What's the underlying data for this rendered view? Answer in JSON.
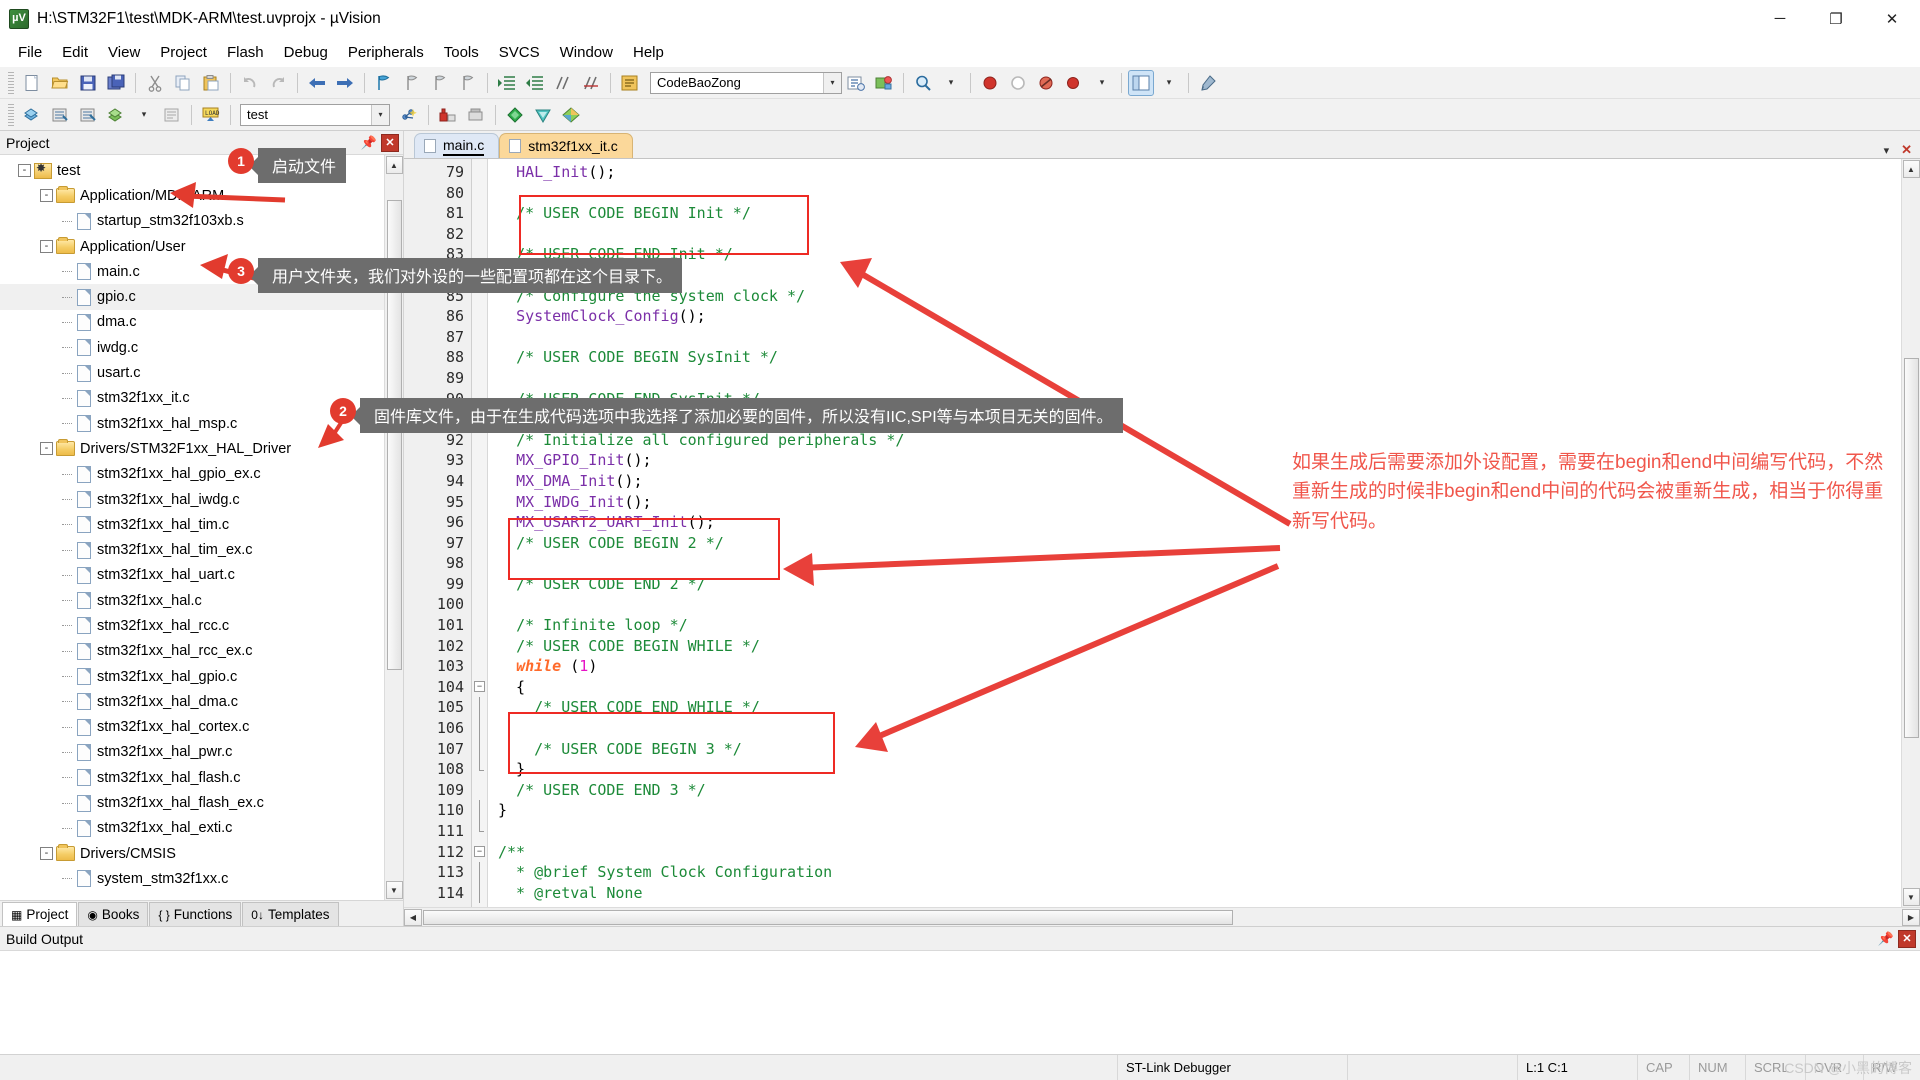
{
  "window": {
    "title": "H:\\STM32F1\\test\\MDK-ARM\\test.uvprojx - µVision",
    "app_icon": "uvision-icon",
    "minimize": "─",
    "maximize": "❐",
    "close": "✕"
  },
  "menubar": {
    "items": [
      "File",
      "Edit",
      "View",
      "Project",
      "Flash",
      "Debug",
      "Peripherals",
      "Tools",
      "SVCS",
      "Window",
      "Help"
    ]
  },
  "toolbar": {
    "target_combo": "CodeBaoZong",
    "project_combo": "test",
    "dropdown_arrow": "▾"
  },
  "project_panel": {
    "caption": "Project",
    "pin": "⚓",
    "close": "✕",
    "tree": [
      {
        "depth": 0,
        "label": "test",
        "icon": "project-icon",
        "twist": "-",
        "selected": false
      },
      {
        "depth": 1,
        "label": "Application/MDK-ARM",
        "icon": "folder-icon",
        "twist": "-",
        "selected": false
      },
      {
        "depth": 2,
        "label": "startup_stm32f103xb.s",
        "icon": "file-icon",
        "twist": "",
        "selected": false
      },
      {
        "depth": 1,
        "label": "Application/User",
        "icon": "folder-icon",
        "twist": "-",
        "selected": false
      },
      {
        "depth": 2,
        "label": "main.c",
        "icon": "file-icon",
        "twist": "",
        "selected": false
      },
      {
        "depth": 2,
        "label": "gpio.c",
        "icon": "file-icon",
        "twist": "",
        "selected": true
      },
      {
        "depth": 2,
        "label": "dma.c",
        "icon": "file-icon",
        "twist": "",
        "selected": false
      },
      {
        "depth": 2,
        "label": "iwdg.c",
        "icon": "file-icon",
        "twist": "",
        "selected": false
      },
      {
        "depth": 2,
        "label": "usart.c",
        "icon": "file-icon",
        "twist": "",
        "selected": false
      },
      {
        "depth": 2,
        "label": "stm32f1xx_it.c",
        "icon": "file-icon",
        "twist": "",
        "selected": false
      },
      {
        "depth": 2,
        "label": "stm32f1xx_hal_msp.c",
        "icon": "file-icon",
        "twist": "",
        "selected": false
      },
      {
        "depth": 1,
        "label": "Drivers/STM32F1xx_HAL_Driver",
        "icon": "folder-icon",
        "twist": "-",
        "selected": false
      },
      {
        "depth": 2,
        "label": "stm32f1xx_hal_gpio_ex.c",
        "icon": "file-icon",
        "twist": "",
        "selected": false
      },
      {
        "depth": 2,
        "label": "stm32f1xx_hal_iwdg.c",
        "icon": "file-icon",
        "twist": "",
        "selected": false
      },
      {
        "depth": 2,
        "label": "stm32f1xx_hal_tim.c",
        "icon": "file-icon",
        "twist": "",
        "selected": false
      },
      {
        "depth": 2,
        "label": "stm32f1xx_hal_tim_ex.c",
        "icon": "file-icon",
        "twist": "",
        "selected": false
      },
      {
        "depth": 2,
        "label": "stm32f1xx_hal_uart.c",
        "icon": "file-icon",
        "twist": "",
        "selected": false
      },
      {
        "depth": 2,
        "label": "stm32f1xx_hal.c",
        "icon": "file-icon",
        "twist": "",
        "selected": false
      },
      {
        "depth": 2,
        "label": "stm32f1xx_hal_rcc.c",
        "icon": "file-icon",
        "twist": "",
        "selected": false
      },
      {
        "depth": 2,
        "label": "stm32f1xx_hal_rcc_ex.c",
        "icon": "file-icon",
        "twist": "",
        "selected": false
      },
      {
        "depth": 2,
        "label": "stm32f1xx_hal_gpio.c",
        "icon": "file-icon",
        "twist": "",
        "selected": false
      },
      {
        "depth": 2,
        "label": "stm32f1xx_hal_dma.c",
        "icon": "file-icon",
        "twist": "",
        "selected": false
      },
      {
        "depth": 2,
        "label": "stm32f1xx_hal_cortex.c",
        "icon": "file-icon",
        "twist": "",
        "selected": false
      },
      {
        "depth": 2,
        "label": "stm32f1xx_hal_pwr.c",
        "icon": "file-icon",
        "twist": "",
        "selected": false
      },
      {
        "depth": 2,
        "label": "stm32f1xx_hal_flash.c",
        "icon": "file-icon",
        "twist": "",
        "selected": false
      },
      {
        "depth": 2,
        "label": "stm32f1xx_hal_flash_ex.c",
        "icon": "file-icon",
        "twist": "",
        "selected": false
      },
      {
        "depth": 2,
        "label": "stm32f1xx_hal_exti.c",
        "icon": "file-icon",
        "twist": "",
        "selected": false
      },
      {
        "depth": 1,
        "label": "Drivers/CMSIS",
        "icon": "folder-icon",
        "twist": "-",
        "selected": false
      },
      {
        "depth": 2,
        "label": "system_stm32f1xx.c",
        "icon": "file-icon",
        "twist": "",
        "selected": false
      }
    ],
    "bottom_tabs": [
      {
        "label": "Project",
        "glyph": "▦",
        "active": true
      },
      {
        "label": "Books",
        "glyph": "◉",
        "active": false
      },
      {
        "label": "Functions",
        "glyph": "{ }",
        "active": false
      },
      {
        "label": "Templates",
        "glyph": "0↓",
        "active": false
      }
    ]
  },
  "editor": {
    "tabs": [
      {
        "label": "main.c",
        "active": true
      },
      {
        "label": "stm32f1xx_it.c",
        "active": false
      }
    ],
    "tab_controls": {
      "dropdown": "▾",
      "close": "✕"
    },
    "first_line_number": 79,
    "lines": [
      {
        "n": 79,
        "fold": "",
        "segs": [
          {
            "t": "  ",
            "c": "pl"
          },
          {
            "t": "HAL_Init",
            "c": "fn"
          },
          {
            "t": "();",
            "c": "pl"
          }
        ]
      },
      {
        "n": 80,
        "fold": "",
        "segs": []
      },
      {
        "n": 81,
        "fold": "",
        "segs": [
          {
            "t": "  ",
            "c": "pl"
          },
          {
            "t": "/* USER CODE BEGIN Init */",
            "c": "cmt"
          }
        ]
      },
      {
        "n": 82,
        "fold": "",
        "segs": []
      },
      {
        "n": 83,
        "fold": "",
        "segs": [
          {
            "t": "  ",
            "c": "pl"
          },
          {
            "t": "/* USER CODE END Init */",
            "c": "cmt"
          }
        ]
      },
      {
        "n": 84,
        "fold": "",
        "segs": []
      },
      {
        "n": 85,
        "fold": "",
        "segs": [
          {
            "t": "  ",
            "c": "pl"
          },
          {
            "t": "/* Configure the system clock */",
            "c": "cmt"
          }
        ]
      },
      {
        "n": 86,
        "fold": "",
        "segs": [
          {
            "t": "  ",
            "c": "pl"
          },
          {
            "t": "SystemClock_Config",
            "c": "fn"
          },
          {
            "t": "();",
            "c": "pl"
          }
        ]
      },
      {
        "n": 87,
        "fold": "",
        "segs": []
      },
      {
        "n": 88,
        "fold": "",
        "segs": [
          {
            "t": "  ",
            "c": "pl"
          },
          {
            "t": "/* USER CODE BEGIN SysInit */",
            "c": "cmt"
          }
        ]
      },
      {
        "n": 89,
        "fold": "",
        "segs": []
      },
      {
        "n": 90,
        "fold": "",
        "segs": [
          {
            "t": "  ",
            "c": "pl"
          },
          {
            "t": "/* USER CODE END SysInit */",
            "c": "cmt"
          }
        ]
      },
      {
        "n": 91,
        "fold": "",
        "segs": []
      },
      {
        "n": 92,
        "fold": "",
        "segs": [
          {
            "t": "  ",
            "c": "pl"
          },
          {
            "t": "/* Initialize all configured peripherals */",
            "c": "cmt"
          }
        ]
      },
      {
        "n": 93,
        "fold": "",
        "segs": [
          {
            "t": "  ",
            "c": "pl"
          },
          {
            "t": "MX_GPIO_Init",
            "c": "fn"
          },
          {
            "t": "();",
            "c": "pl"
          }
        ]
      },
      {
        "n": 94,
        "fold": "",
        "segs": [
          {
            "t": "  ",
            "c": "pl"
          },
          {
            "t": "MX_DMA_Init",
            "c": "fn"
          },
          {
            "t": "();",
            "c": "pl"
          }
        ]
      },
      {
        "n": 95,
        "fold": "",
        "segs": [
          {
            "t": "  ",
            "c": "pl"
          },
          {
            "t": "MX_IWDG_Init",
            "c": "fn"
          },
          {
            "t": "();",
            "c": "pl"
          }
        ]
      },
      {
        "n": 96,
        "fold": "",
        "segs": [
          {
            "t": "  ",
            "c": "pl"
          },
          {
            "t": "MX_USART2_UART_Init",
            "c": "fn"
          },
          {
            "t": "();",
            "c": "pl"
          }
        ]
      },
      {
        "n": 97,
        "fold": "",
        "segs": [
          {
            "t": "  ",
            "c": "pl"
          },
          {
            "t": "/* USER CODE BEGIN 2 */",
            "c": "cmt"
          }
        ]
      },
      {
        "n": 98,
        "fold": "",
        "segs": []
      },
      {
        "n": 99,
        "fold": "",
        "segs": [
          {
            "t": "  ",
            "c": "pl"
          },
          {
            "t": "/* USER CODE END 2 */",
            "c": "cmt"
          }
        ]
      },
      {
        "n": 100,
        "fold": "",
        "segs": []
      },
      {
        "n": 101,
        "fold": "",
        "segs": [
          {
            "t": "  ",
            "c": "pl"
          },
          {
            "t": "/* Infinite loop */",
            "c": "cmt"
          }
        ]
      },
      {
        "n": 102,
        "fold": "",
        "segs": [
          {
            "t": "  ",
            "c": "pl"
          },
          {
            "t": "/* USER CODE BEGIN WHILE */",
            "c": "cmt"
          }
        ]
      },
      {
        "n": 103,
        "fold": "",
        "segs": [
          {
            "t": "  ",
            "c": "pl"
          },
          {
            "t": "while",
            "c": "kw"
          },
          {
            "t": " (",
            "c": "pl"
          },
          {
            "t": "1",
            "c": "num"
          },
          {
            "t": ")",
            "c": "pl"
          }
        ]
      },
      {
        "n": 104,
        "fold": "-",
        "segs": [
          {
            "t": "  {",
            "c": "pl"
          }
        ]
      },
      {
        "n": 105,
        "fold": "|",
        "segs": [
          {
            "t": "    ",
            "c": "pl"
          },
          {
            "t": "/* USER CODE END WHILE */",
            "c": "cmt"
          }
        ]
      },
      {
        "n": 106,
        "fold": "|",
        "segs": []
      },
      {
        "n": 107,
        "fold": "|",
        "segs": [
          {
            "t": "    ",
            "c": "pl"
          },
          {
            "t": "/* USER CODE BEGIN 3 */",
            "c": "cmt"
          }
        ]
      },
      {
        "n": 108,
        "fold": "e",
        "segs": [
          {
            "t": "  }",
            "c": "pl"
          }
        ]
      },
      {
        "n": 109,
        "fold": "",
        "segs": [
          {
            "t": "  ",
            "c": "pl"
          },
          {
            "t": "/* USER CODE END 3 */",
            "c": "cmt"
          }
        ]
      },
      {
        "n": 110,
        "fold": "|",
        "segs": [
          {
            "t": "}",
            "c": "pl"
          }
        ]
      },
      {
        "n": 111,
        "fold": "e",
        "segs": []
      },
      {
        "n": 112,
        "fold": "-",
        "segs": [
          {
            "t": "/**",
            "c": "cmt"
          }
        ]
      },
      {
        "n": 113,
        "fold": "|",
        "segs": [
          {
            "t": "  * @brief System Clock Configuration",
            "c": "cmt"
          }
        ]
      },
      {
        "n": 114,
        "fold": "|",
        "segs": [
          {
            "t": "  * @retval None",
            "c": "cmt"
          }
        ]
      }
    ]
  },
  "build_output": {
    "caption": "Build Output",
    "pin": "⚓",
    "close": "✕",
    "content": ""
  },
  "statusbar": {
    "left": "",
    "debugger": "ST-Link Debugger",
    "cursor": "L:1 C:1",
    "cap": "CAP",
    "num": "NUM",
    "scrl": "SCRL",
    "ovr": "OVR",
    "rw": "R/W"
  },
  "annotations": {
    "callout_1": {
      "badge": "1",
      "text": "启动文件"
    },
    "callout_3": {
      "badge": "3",
      "text": "用户文件夹，我们对外设的一些配置项都在这个目录下。"
    },
    "callout_2": {
      "badge": "2",
      "text": "固件库文件，由于在生成代码选项中我选择了添加必要的固件，所以没有IIC,SPI等与本项目无关的固件。"
    },
    "note_right": "如果生成后需要添加外设配置，需要在begin和end中间编写代码，不然\n重新生成的时候非begin和end中间的代码会被重新生成，相当于你得重\n新写代码。",
    "watermark": "CSDN @小黑的博客"
  },
  "colors": {
    "annotation_red": "#f0564b",
    "box_red": "#ee2a24",
    "badge_red": "#e23b2e",
    "callout_gray": "#6d6d6d",
    "comment_green": "#1c8a38",
    "keyword_orange": "#ff6a2a",
    "function_purple": "#7b2fa8",
    "number_magenta": "#e612c6"
  }
}
